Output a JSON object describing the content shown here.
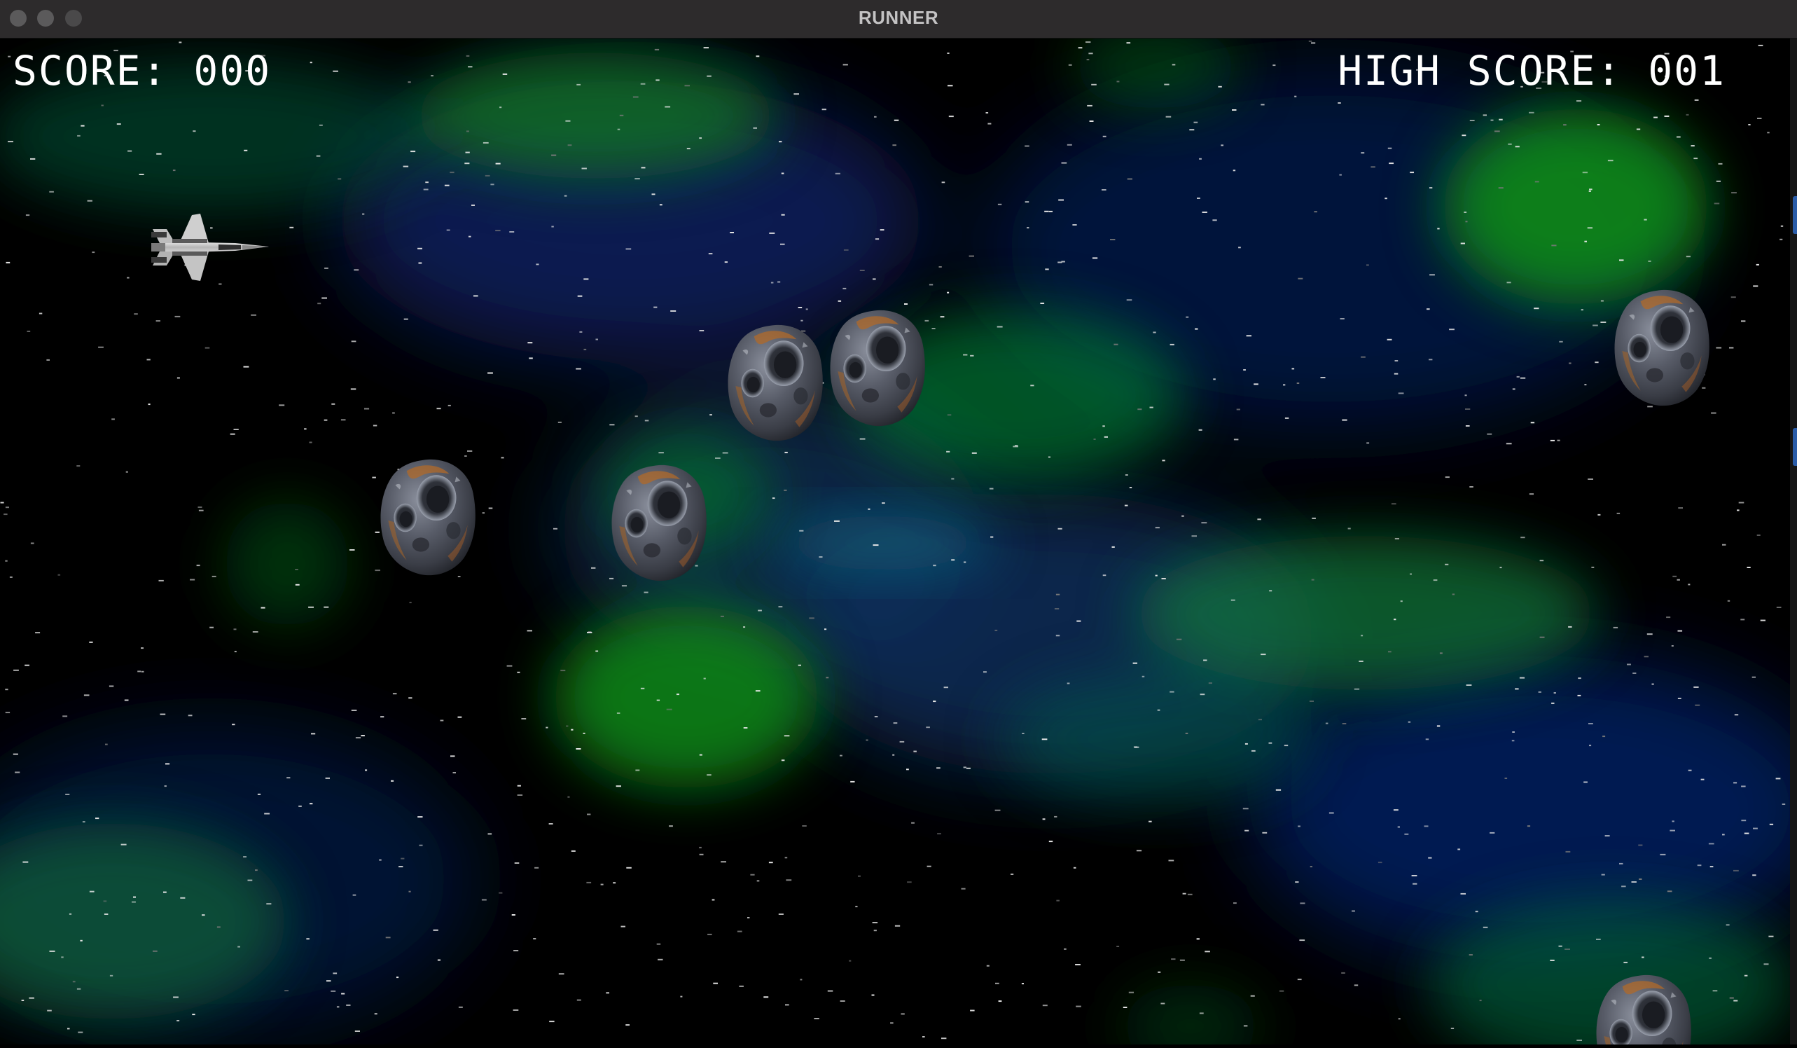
{
  "window": {
    "title": "RUNNER"
  },
  "hud": {
    "score_label": "SCORE: 000",
    "high_score_label": "HIGH SCORE: 001"
  },
  "sprites": {
    "player": "spaceship-icon",
    "obstacles": "asteroid-icon"
  },
  "colors": {
    "nebula_green": "#0a8a1a",
    "nebula_blue": "#0a2a6a",
    "space": "#000000",
    "hud_text": "#ffffff"
  }
}
